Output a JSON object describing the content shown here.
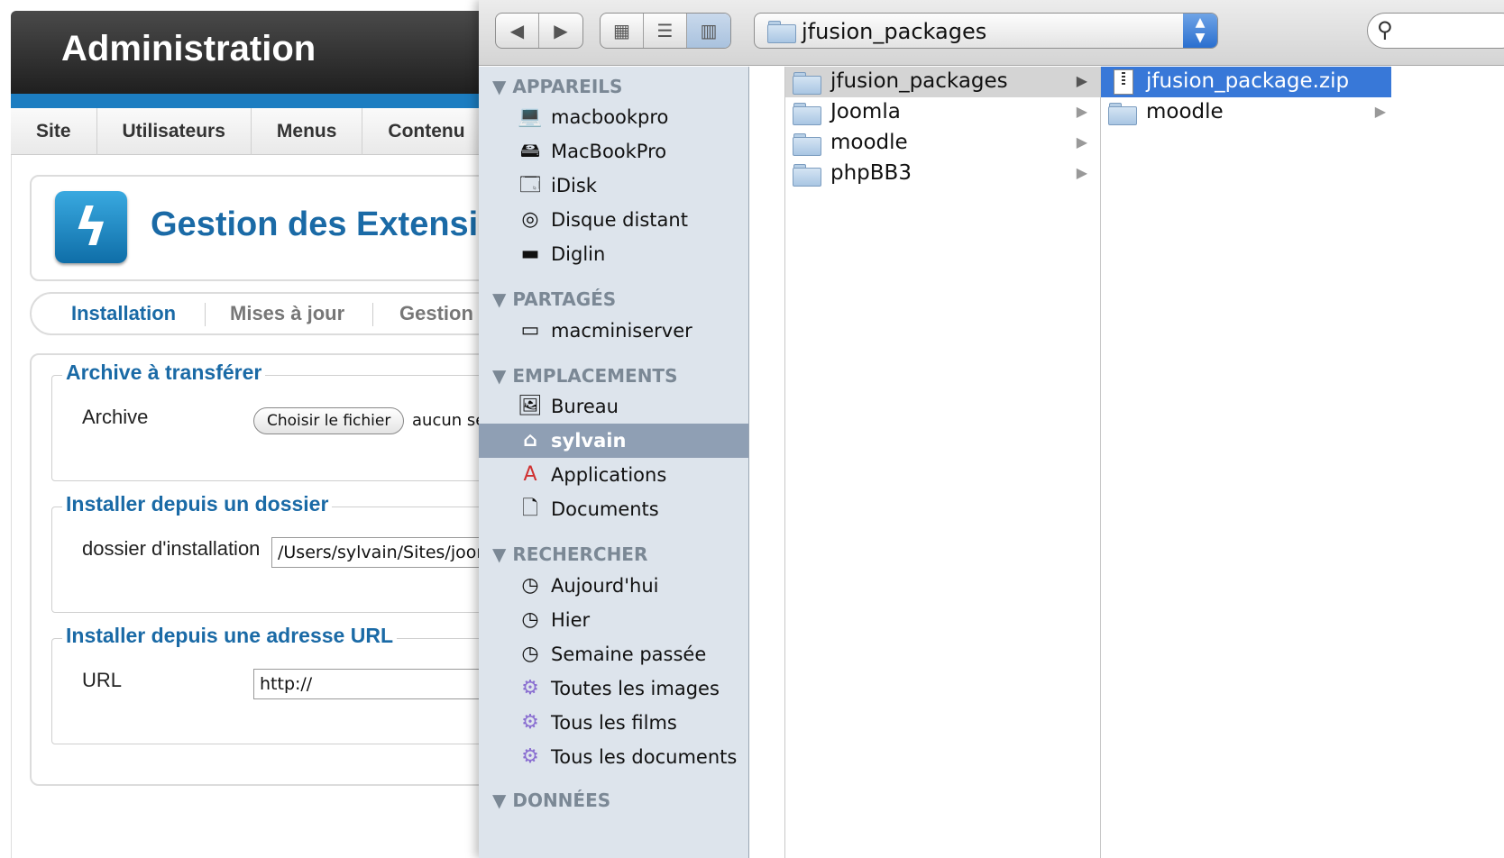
{
  "admin": {
    "header_title": "Administration",
    "menu": [
      "Site",
      "Utilisateurs",
      "Menus",
      "Contenu"
    ],
    "page_title": "Gestion des Extensions",
    "tabs": [
      "Installation",
      "Mises à jour",
      "Gestion"
    ],
    "sections": {
      "archive": {
        "legend": "Archive à transférer",
        "label": "Archive",
        "button": "Choisir le fichier",
        "status": "aucun sélectionné"
      },
      "folder": {
        "legend": "Installer depuis un dossier",
        "label": "dossier d'installation",
        "value": "/Users/sylvain/Sites/joomla"
      },
      "url": {
        "legend": "Installer depuis une adresse URL",
        "label": "URL",
        "value": "http://"
      }
    }
  },
  "dialog": {
    "current_folder": "jfusion_packages",
    "view_mode": "columns",
    "sidebar": {
      "sections": [
        {
          "title": "APPAREILS",
          "items": [
            {
              "label": "macbookpro",
              "icon": "laptop-icon"
            },
            {
              "label": "MacBookPro",
              "icon": "hard-drive-icon"
            },
            {
              "label": "iDisk",
              "icon": "idisk-icon"
            },
            {
              "label": "Disque distant",
              "icon": "optical-disc-icon"
            },
            {
              "label": "Diglin",
              "icon": "external-drive-icon"
            }
          ]
        },
        {
          "title": "PARTAGÉS",
          "items": [
            {
              "label": "macminiserver",
              "icon": "server-icon"
            }
          ]
        },
        {
          "title": "EMPLACEMENTS",
          "items": [
            {
              "label": "Bureau",
              "icon": "desktop-icon"
            },
            {
              "label": "sylvain",
              "icon": "home-icon"
            },
            {
              "label": "Applications",
              "icon": "applications-icon"
            },
            {
              "label": "Documents",
              "icon": "document-icon"
            }
          ]
        },
        {
          "title": "RECHERCHER",
          "items": [
            {
              "label": "Aujourd'hui",
              "icon": "clock-icon"
            },
            {
              "label": "Hier",
              "icon": "clock-icon"
            },
            {
              "label": "Semaine passée",
              "icon": "clock-icon"
            },
            {
              "label": "Toutes les images",
              "icon": "smart-folder-icon"
            },
            {
              "label": "Tous les films",
              "icon": "smart-folder-icon"
            },
            {
              "label": "Tous les documents",
              "icon": "smart-folder-icon"
            }
          ]
        },
        {
          "title": "DONNÉES",
          "items": []
        }
      ],
      "selected": "sylvain"
    },
    "column_2": [
      "jfusion_packages",
      "Joomla",
      "moodle",
      "phpBB3"
    ],
    "column_3": [
      {
        "label": "jfusion_package.zip",
        "type": "zip"
      },
      {
        "label": "moodle",
        "type": "folder"
      }
    ]
  }
}
